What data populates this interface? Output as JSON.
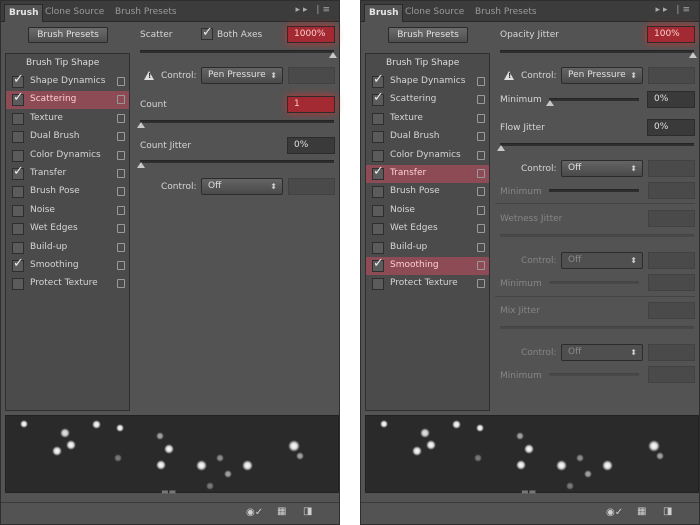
{
  "tabs": [
    "Brush",
    "Clone Source",
    "Brush Presets"
  ],
  "brush_presets_button": "Brush Presets",
  "brush_tip_shape": "Brush Tip Shape",
  "left": {
    "items": [
      {
        "label": "Shape Dynamics",
        "checked": true
      },
      {
        "label": "Scattering",
        "checked": true,
        "highlighted": true
      },
      {
        "label": "Texture",
        "checked": false
      },
      {
        "label": "Dual Brush",
        "checked": false
      },
      {
        "label": "Color Dynamics",
        "checked": false
      },
      {
        "label": "Transfer",
        "checked": true
      },
      {
        "label": "Brush Pose",
        "checked": false
      },
      {
        "label": "Noise",
        "checked": false
      },
      {
        "label": "Wet Edges",
        "checked": false
      },
      {
        "label": "Build-up",
        "checked": false
      },
      {
        "label": "Smoothing",
        "checked": true
      },
      {
        "label": "Protect Texture",
        "checked": false
      }
    ],
    "scatter_label": "Scatter",
    "both_axes_label": "Both Axes",
    "scatter_value": "1000%",
    "control_label": "Control:",
    "control_value": "Pen Pressure",
    "count_label": "Count",
    "count_value": "1",
    "count_jitter_label": "Count Jitter",
    "count_jitter_value": "0%",
    "control2_label": "Control:",
    "control2_value": "Off"
  },
  "right": {
    "items": [
      {
        "label": "Shape Dynamics",
        "checked": true
      },
      {
        "label": "Scattering",
        "checked": true
      },
      {
        "label": "Texture",
        "checked": false
      },
      {
        "label": "Dual Brush",
        "checked": false
      },
      {
        "label": "Color Dynamics",
        "checked": false
      },
      {
        "label": "Transfer",
        "checked": true,
        "highlighted": true
      },
      {
        "label": "Brush Pose",
        "checked": false
      },
      {
        "label": "Noise",
        "checked": false
      },
      {
        "label": "Wet Edges",
        "checked": false
      },
      {
        "label": "Build-up",
        "checked": false
      },
      {
        "label": "Smoothing",
        "checked": true,
        "highlighted": true
      },
      {
        "label": "Protect Texture",
        "checked": false
      }
    ],
    "opacity_jitter_label": "Opacity Jitter",
    "opacity_jitter_value": "100%",
    "control_label": "Control:",
    "control_value": "Pen Pressure",
    "minimum_label": "Minimum",
    "minimum_value": "0%",
    "flow_jitter_label": "Flow Jitter",
    "flow_jitter_value": "0%",
    "flow_control_label": "Control:",
    "flow_control_value": "Off",
    "flow_minimum_label": "Minimum",
    "wetness_jitter_label": "Wetness Jitter",
    "wet_control_label": "Control:",
    "wet_control_value": "Off",
    "wet_minimum_label": "Minimum",
    "mix_jitter_label": "Mix Jitter",
    "mix_control_label": "Control:",
    "mix_control_value": "Off",
    "mix_minimum_label": "Minimum"
  },
  "icons": {
    "collapse": "double-chevron-icon",
    "menu": "panel-menu-icon",
    "lock": "lock-icon",
    "warning": "warning-icon",
    "brush_toggle": "brush-toggle-icon",
    "grid": "grid-icon",
    "new_preset": "new-preset-icon",
    "resize": "resize-grip-icon"
  }
}
